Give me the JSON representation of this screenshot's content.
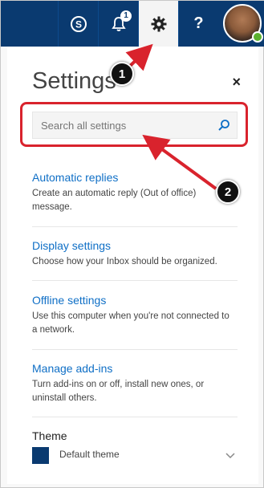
{
  "topbar": {
    "skype_icon": "skype-icon",
    "notification_icon": "bell-icon",
    "notification_count": "1",
    "settings_icon": "gear-icon",
    "help_label": "?",
    "accent_color": "#0a3a70"
  },
  "settings": {
    "title": "Settings",
    "close_label": "×",
    "search_placeholder": "Search all settings",
    "items": [
      {
        "label": "Automatic replies",
        "description": "Create an automatic reply (Out of office) message."
      },
      {
        "label": "Display settings",
        "description": "Choose how your Inbox should be organized."
      },
      {
        "label": "Offline settings",
        "description": "Use this computer when you're not connected to a network."
      },
      {
        "label": "Manage add-ins",
        "description": "Turn add-ins on or off, install new ones, or uninstall others."
      }
    ],
    "theme": {
      "label": "Theme",
      "value": "Default theme",
      "swatch_color": "#0a3a70"
    }
  },
  "annotations": {
    "callout_1": "1",
    "callout_2": "2",
    "highlight_color": "#d9232d"
  }
}
